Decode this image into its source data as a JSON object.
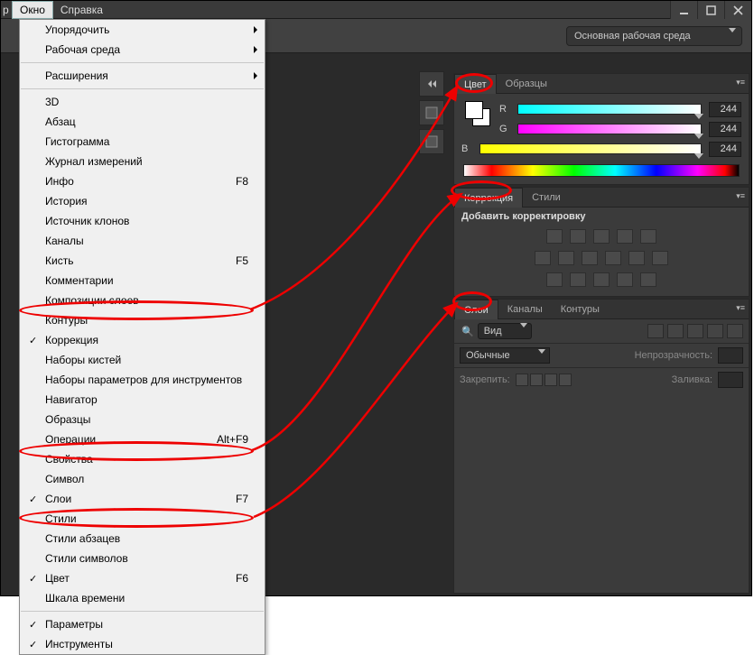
{
  "menubar": {
    "corner": "р",
    "window": "Окно",
    "help": "Справка"
  },
  "workspace": {
    "selected": "Основная рабочая среда"
  },
  "dropdown": {
    "arrange": "Упорядочить",
    "workspace": "Рабочая среда",
    "extensions": "Расширения",
    "three_d": "3D",
    "paragraph": "Абзац",
    "histogram": "Гистограмма",
    "log": "Журнал измерений",
    "info": "Инфо",
    "info_sc": "F8",
    "history": "История",
    "clone_src": "Источник клонов",
    "channels": "Каналы",
    "brush": "Кисть",
    "brush_sc": "F5",
    "comments": "Комментарии",
    "layer_comps": "Композиции слоев",
    "paths": "Контуры",
    "adjustments": "Коррекция",
    "brush_presets": "Наборы кистей",
    "tool_presets": "Наборы параметров для инструментов",
    "navigator": "Навигатор",
    "swatches": "Образцы",
    "actions": "Операции",
    "actions_sc": "Alt+F9",
    "properties": "Свойства",
    "character": "Символ",
    "layers": "Слои",
    "layers_sc": "F7",
    "styles": "Стили",
    "para_styles": "Стили абзацев",
    "char_styles": "Стили символов",
    "color": "Цвет",
    "color_sc": "F6",
    "timeline": "Шкала времени",
    "options": "Параметры",
    "tools": "Инструменты"
  },
  "panels": {
    "color_tab": "Цвет",
    "swatches_tab": "Образцы",
    "r": "R",
    "r_val": "244",
    "g": "G",
    "g_val": "244",
    "b": "B",
    "b_val": "244",
    "adj_tab": "Коррекция",
    "styles_tab": "Стили",
    "adj_title": "Добавить корректировку",
    "layers_tab": "Слои",
    "channels_tab": "Каналы",
    "paths_tab": "Контуры",
    "filter_kind": "Вид",
    "blend_mode": "Обычные",
    "opacity_label": "Непрозрачность:",
    "lock_label": "Закрепить:",
    "fill_label": "Заливка:"
  }
}
